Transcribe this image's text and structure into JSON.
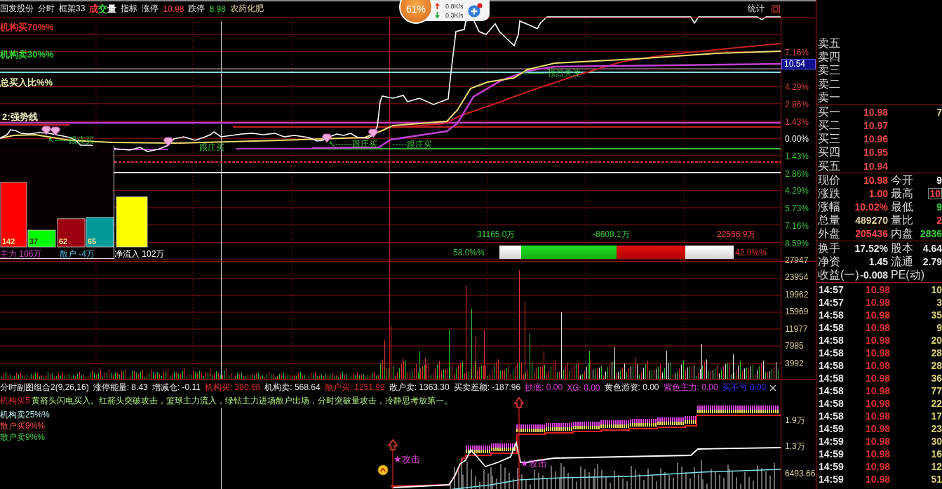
{
  "top_bar": {
    "stock_name": "国发股份",
    "menu_items": [
      {
        "label": "分时"
      },
      {
        "label": "框架33"
      }
    ],
    "volume_menu": [
      {
        "text": "成",
        "color": "#ff4040"
      },
      {
        "text": "交",
        "color": "#40e040"
      },
      {
        "text": "量",
        "color": "#ffffff"
      }
    ],
    "indicator_menu": "指标",
    "limits": [
      {
        "label": "涨停",
        "value": "10.98",
        "kind": "up"
      },
      {
        "label": "跌停",
        "value": "8.98",
        "kind": "down"
      }
    ],
    "sector": "农药化肥",
    "stats_tab": "统计"
  },
  "speed_widget": {
    "percent": "61%",
    "upload": "0.8K/s",
    "download": "0.3K/s"
  },
  "price_chart": {
    "labels": [
      {
        "text": "机构买70%%",
        "color": "#e03030"
      },
      {
        "text": "机构卖30%%",
        "color": "#30d030"
      },
      {
        "text": "总买入比%%",
        "color": "#f0f0b0"
      },
      {
        "text": "2:强势线",
        "color": "#f0f0c8"
      }
    ],
    "annotations": [
      "↖-----跟庄买",
      "跟庄买",
      "↖------跟庄买",
      "-----跟庄买",
      "<-------强烈关注"
    ],
    "axis_labels": [
      {
        "text": "7.16%",
        "kind": "up"
      },
      {
        "text": "10.54",
        "kind": "tag"
      },
      {
        "text": "4.29%",
        "kind": "up"
      },
      {
        "text": "2.86%",
        "kind": "up"
      },
      {
        "text": "1.43%",
        "kind": "up"
      },
      {
        "text": "0.00%",
        "kind": "flat"
      },
      {
        "text": "1.43%",
        "kind": "down"
      },
      {
        "text": "2.86%",
        "kind": "down"
      },
      {
        "text": "4.29%",
        "kind": "down"
      },
      {
        "text": "5.73%",
        "kind": "down"
      },
      {
        "text": "7.16%",
        "kind": "down"
      },
      {
        "text": "8.59%",
        "kind": "down"
      }
    ],
    "flow_chart": {
      "chart_data": {
        "type": "bar",
        "categories": [
          "主力 106万",
          "散户 -4万",
          "净流入 102万"
        ],
        "series": [
          {
            "colors": [
              "#ff0000",
              "#9a0010",
              "#ffff00"
            ],
            "values": [
              142,
              62,
              110
            ],
            "value_labels": [
              "142",
              "62",
              null
            ]
          },
          {
            "colors": [
              "#00ff00",
              "#009a9a",
              null
            ],
            "values": [
              37,
              65,
              null
            ],
            "value_labels": [
              "37",
              "65",
              null
            ]
          }
        ],
        "ylim": [
          0,
          142
        ]
      },
      "category_styles": [
        {
          "color": "#d048d0"
        },
        {
          "color": "#48b8e0"
        },
        {
          "color": "#ffffff"
        }
      ]
    },
    "amounts": [
      {
        "text": "31165.0万",
        "kind": "down"
      },
      {
        "text": "-8608.1万",
        "kind": "down"
      },
      {
        "text": "22556.9万",
        "kind": "up"
      }
    ],
    "ratio_bar": {
      "level": 0.58,
      "left_label": "58.0%%",
      "right_label": "42.0%%"
    }
  },
  "volume_chart": {
    "axis_labels": [
      "27947",
      "23954",
      "19962",
      "15969",
      "11977",
      "7985",
      "3992"
    ]
  },
  "sub_chart": {
    "title": "分时副图组合2(9,26,16)",
    "readouts": [
      {
        "text": "涨停能量: 8.43",
        "color": "#f0f0f0"
      },
      {
        "text": "增减仓: -0.11",
        "color": "#f0f0f0"
      },
      {
        "text": "机构买: 380.68",
        "color": "#e03030"
      },
      {
        "text": "机构卖: 568.64",
        "color": "#e8e8e8"
      },
      {
        "text": "散户买: 1251.92",
        "color": "#e03030"
      },
      {
        "text": "散户卖: 1363.30",
        "color": "#e8e8e8"
      },
      {
        "text": "买卖差额: -187.96",
        "color": "#e8e8e8"
      },
      {
        "text": "抄底: 0.00",
        "color": "#e040e0"
      },
      {
        "text": "XG: 0.00",
        "color": "#e040e0"
      },
      {
        "text": "黄色游资: 0.00",
        "color": "#e8e8e8"
      },
      {
        "text": "紫色主力: 0.00",
        "color": "#e040e0"
      },
      {
        "text": "买不亏 0.00",
        "color": "#3838ff"
      }
    ],
    "legend": [
      {
        "text": "机构买5",
        "color": "#e03030"
      },
      {
        "text": "机构卖25%%",
        "color": "#c8f0f0"
      },
      {
        "text": "散户买9%%",
        "color": "#ff5050"
      },
      {
        "text": "散户卖9%%",
        "color": "#50d050"
      }
    ],
    "description": "黄箭头闪电买入。红箭头突破攻击，篮球主力流入，绿钻主力进场散户出场，分时突破量攻击，冷静思考放第一。",
    "signals": [
      "★攻击",
      "★攻击"
    ],
    "axis_labels": [
      "1.9万",
      "1.3万",
      "6493.66"
    ]
  },
  "order_book": {
    "asks": [
      {
        "label": "卖五"
      },
      {
        "label": "卖四"
      },
      {
        "label": "卖三"
      },
      {
        "label": "卖二"
      },
      {
        "label": "卖一"
      }
    ],
    "bids": [
      {
        "label": "买一",
        "price": "10.98",
        "volume": "7"
      },
      {
        "label": "买二",
        "price": "10.97"
      },
      {
        "label": "买三",
        "price": "10.96"
      },
      {
        "label": "买四",
        "price": "10.95"
      },
      {
        "label": "买五",
        "price": "10.94"
      }
    ]
  },
  "quote": [
    {
      "left": {
        "label": "现价",
        "value": "10.98",
        "kind": "up"
      },
      "right": {
        "label": "今开",
        "value": "9",
        "kind": "flat",
        "boxed": false
      }
    },
    {
      "left": {
        "label": "涨跌",
        "value": "1.00",
        "kind": "up"
      },
      "right": {
        "label": "最高",
        "value": "10",
        "kind": "up",
        "boxed": true
      }
    },
    {
      "left": {
        "label": "涨幅",
        "value": "10.02%",
        "kind": "up"
      },
      "right": {
        "label": "最低",
        "value": "9",
        "kind": "down",
        "boxed": false
      }
    },
    {
      "left": {
        "label": "总量",
        "value": "489270",
        "kind": "volume"
      },
      "right": {
        "label": "量比",
        "value": "2",
        "kind": "up",
        "boxed": false
      }
    },
    {
      "left": {
        "label": "外盘",
        "value": "205436",
        "kind": "up"
      },
      "right": {
        "label": "内盘",
        "value": "2836",
        "kind": "down",
        "boxed": false
      }
    }
  ],
  "fundamentals": [
    {
      "left": {
        "label": "换手",
        "value": "17.52%"
      },
      "right": {
        "label": "股本",
        "value": "4.64"
      }
    },
    {
      "left": {
        "label": "净资",
        "value": "1.45"
      },
      "right": {
        "label": "流通",
        "value": "2.79"
      }
    },
    {
      "left": {
        "label": "收益(一)",
        "value": "-0.008"
      },
      "right": {
        "label": "PE(动)"
      }
    }
  ],
  "ticks": [
    {
      "time": "14:57",
      "price": "10.98",
      "volume": "10"
    },
    {
      "time": "14:57",
      "price": "10.98",
      "volume": "3"
    },
    {
      "time": "14:58",
      "price": "10.98",
      "volume": "35"
    },
    {
      "time": "14:58",
      "price": "10.98",
      "volume": "9"
    },
    {
      "time": "14:58",
      "price": "10.98",
      "volume": "20"
    },
    {
      "time": "14:58",
      "price": "10.98",
      "volume": "28"
    },
    {
      "time": "14:58",
      "price": "10.98",
      "volume": "28"
    },
    {
      "time": "14:58",
      "price": "10.98",
      "volume": "36"
    },
    {
      "time": "14:58",
      "price": "10.98",
      "volume": "77"
    },
    {
      "time": "14:58",
      "price": "10.98",
      "volume": "22"
    },
    {
      "time": "14:58",
      "price": "10.98",
      "volume": "17"
    },
    {
      "time": "14:59",
      "price": "10.98",
      "volume": "23"
    },
    {
      "time": "14:59",
      "price": "10.98",
      "volume": "30"
    },
    {
      "time": "14:59",
      "price": "10.98",
      "volume": "16"
    },
    {
      "time": "14:59",
      "price": "10.98",
      "volume": "12"
    },
    {
      "time": "14:59",
      "price": "10.98",
      "volume": "51"
    }
  ]
}
